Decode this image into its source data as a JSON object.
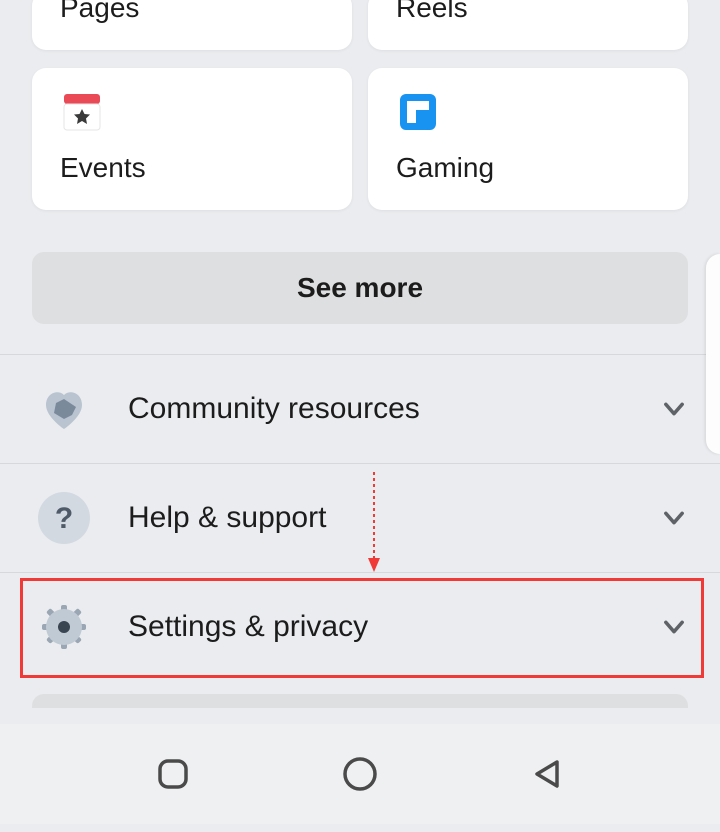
{
  "grid": {
    "row1": [
      {
        "label": "Pages"
      },
      {
        "label": "Reels"
      }
    ],
    "row2": [
      {
        "label": "Events"
      },
      {
        "label": "Gaming"
      }
    ]
  },
  "see_more": "See more",
  "list": [
    {
      "label": "Community resources"
    },
    {
      "label": "Help & support"
    },
    {
      "label": "Settings & privacy"
    }
  ]
}
